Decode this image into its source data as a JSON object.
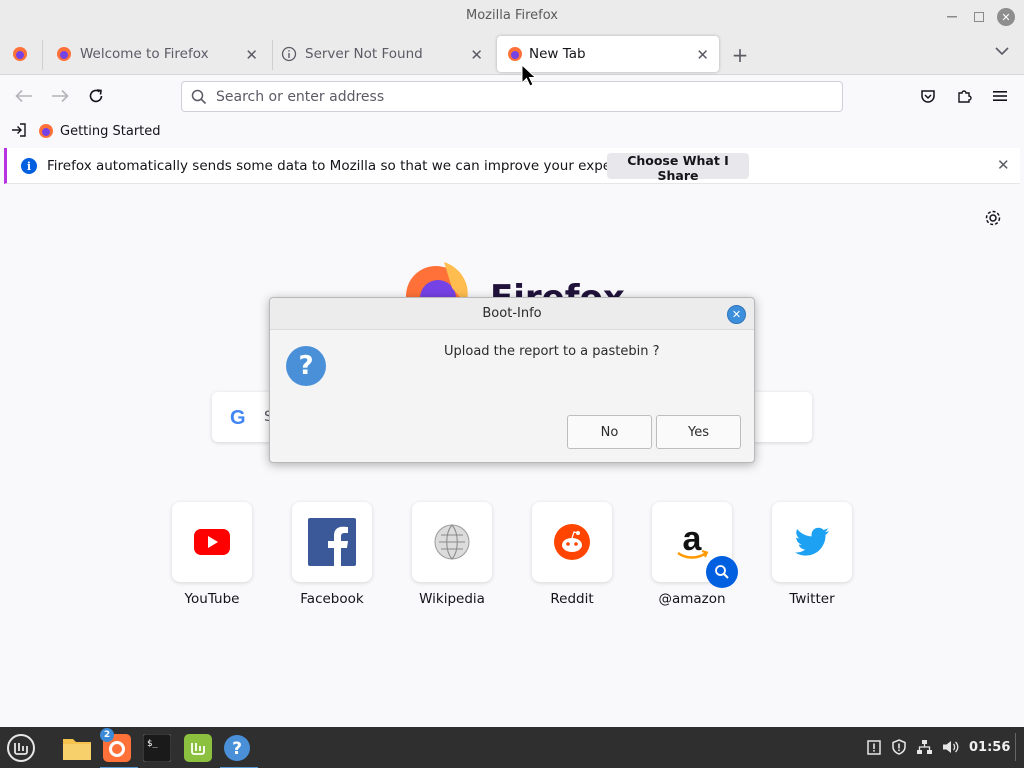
{
  "window": {
    "title": "Mozilla Firefox"
  },
  "tabs": [
    {
      "label": "Welcome to Firefox",
      "icon": "firefox-icon"
    },
    {
      "label": "Server Not Found",
      "icon": "info-icon"
    },
    {
      "label": "New Tab",
      "icon": "firefox-icon",
      "active": true
    }
  ],
  "urlbar": {
    "placeholder": "Search or enter address",
    "value": ""
  },
  "bookmarks": [
    {
      "label": "Getting Started"
    }
  ],
  "notification": {
    "message": "Firefox automatically sends some data to Mozilla so that we can improve your experience.",
    "button": "Choose What I Share"
  },
  "newtab": {
    "brand": "Firefox",
    "search_placeholder": "S",
    "shortcuts": [
      {
        "label": "YouTube",
        "icon": "youtube-icon"
      },
      {
        "label": "Facebook",
        "icon": "facebook-icon"
      },
      {
        "label": "Wikipedia",
        "icon": "wikipedia-icon"
      },
      {
        "label": "Reddit",
        "icon": "reddit-icon"
      },
      {
        "label": "@amazon",
        "icon": "amazon-icon",
        "sponsored": true
      },
      {
        "label": "Twitter",
        "icon": "twitter-icon"
      }
    ]
  },
  "dialog": {
    "title": "Boot-Info",
    "message": "Upload the report to a pastebin ?",
    "no_label": "No",
    "yes_label": "Yes"
  },
  "taskbar": {
    "firefox_badge": "2",
    "clock": "01:56"
  },
  "colors": {
    "accent": "#0060df",
    "notif_border": "#b833e1",
    "dialog_accent": "#3d8fdc",
    "taskbar": "#2f2f2f"
  }
}
